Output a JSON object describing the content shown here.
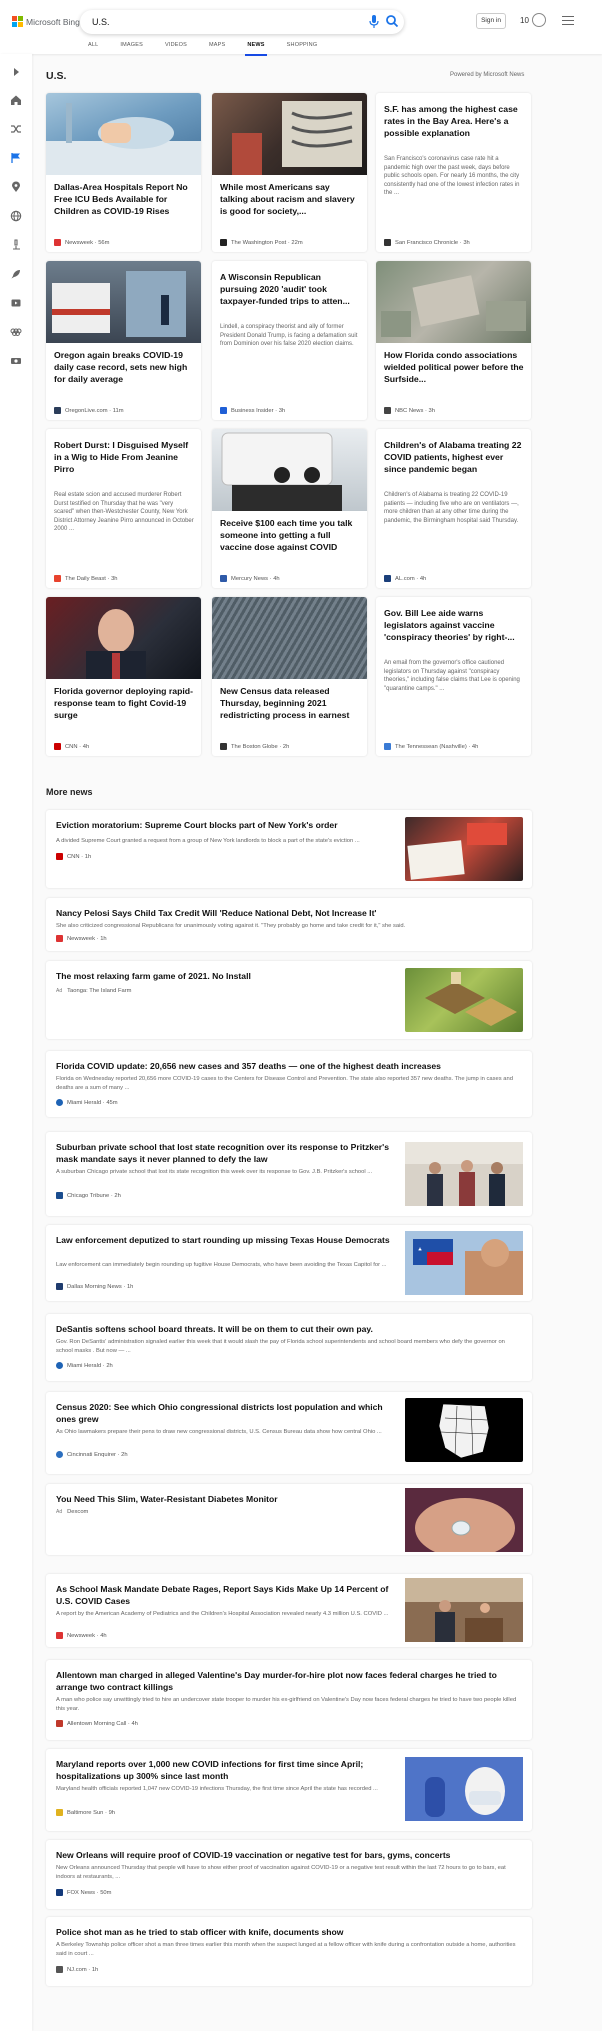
{
  "brand": {
    "name": "Microsoft Bing",
    "colors": [
      "#f25022",
      "#7fba00",
      "#00a4ef",
      "#ffb900"
    ]
  },
  "search": {
    "query": "U.S."
  },
  "header": {
    "signin": "Sign in",
    "rewards": "10"
  },
  "tabs": [
    "ALL",
    "IMAGES",
    "VIDEOS",
    "MAPS",
    "NEWS",
    "SHOPPING"
  ],
  "active_tab": "NEWS",
  "rail_icons": [
    "expand-icon",
    "home-icon",
    "shuffle-icon",
    "flag-icon",
    "location-icon",
    "globe-icon",
    "microscope-icon",
    "rocket-icon",
    "video-icon",
    "rings-icon",
    "money-icon"
  ],
  "section": {
    "title": "U.S.",
    "powered": "Powered by Microsoft News"
  },
  "cards": [
    {
      "title": "Dallas-Area Hospitals Report No Free ICU Beds Available for Children as COVID-19 Rises",
      "snippet": "",
      "source": "Newsweek",
      "time": "56m",
      "fav": "#d33"
    },
    {
      "title": "While most Americans say talking about racism and slavery is good for society,...",
      "snippet": "",
      "source": "The Washington Post",
      "time": "22m",
      "fav": "#222"
    },
    {
      "title": "S.F. has among the highest case rates in the Bay Area. Here's a possible explanation",
      "snippet": "San Francisco's coronavirus case rate hit a pandemic high over the past week, days before public schools open. For nearly 16 months, the city consistently had one of the lowest infection rates in the ...",
      "source": "San Francisco Chronicle",
      "time": "3h",
      "fav": "#333"
    },
    {
      "title": "Oregon again breaks COVID-19 daily case record, sets new high for daily average",
      "snippet": "",
      "source": "OregonLive.com",
      "time": "11m",
      "fav": "#2b3d5a"
    },
    {
      "title": "A Wisconsin Republican pursuing 2020 'audit' took taxpayer-funded trips to atten...",
      "snippet": "Lindell, a conspiracy theorist and ally of former President Donald Trump, is facing a defamation suit from Dominion over his false 2020 election claims.",
      "source": "Business Insider",
      "time": "3h",
      "fav": "#1f5fd6"
    },
    {
      "title": "How Florida condo associations wielded political power before the Surfside...",
      "snippet": "",
      "source": "NBC News",
      "time": "3h",
      "fav": "#444"
    },
    {
      "title": "Robert Durst: I Disguised Myself in a Wig to Hide From Jeanine Pirro",
      "snippet": "Real estate scion and accused murderer Robert Durst testified on Thursday that he was \"very scared\" when then-Westchester County, New York District Attorney Jeanine Pirro announced in October 2000 ...",
      "source": "The Daily Beast",
      "time": "3h",
      "fav": "#e8432e"
    },
    {
      "title": "Receive $100 each time you talk someone into getting a full vaccine dose against COVID",
      "snippet": "",
      "source": "Mercury News",
      "time": "4h",
      "fav": "#2e5aa8"
    },
    {
      "title": "Children's of Alabama treating 22 COVID patients, highest ever since pandemic began",
      "snippet": "Children's of Alabama is treating 22 COVID-19 patients — including five who are on ventilators —, more children than at any other time during the pandemic, the Birmingham hospital said Thursday.",
      "source": "AL.com",
      "time": "4h",
      "fav": "#1b3f7a"
    },
    {
      "title": "Florida governor deploying rapid-response team to fight Covid-19 surge",
      "snippet": "",
      "source": "CNN",
      "time": "4h",
      "fav": "#cc0000"
    },
    {
      "title": "New Census data released Thursday, beginning 2021 redistricting process in earnest",
      "snippet": "",
      "source": "The Boston Globe",
      "time": "2h",
      "fav": "#333"
    },
    {
      "title": "Gov. Bill Lee aide warns legislators against vaccine 'conspiracy theories' by right-...",
      "snippet": "An email from the governor's office cautioned legislators on Thursday against \"conspiracy theories,\" including false claims that Lee is opening \"quarantine camps.\" ...",
      "source": "The Tennessean (Nashville)",
      "time": "4h",
      "fav": "#3a7bd5"
    }
  ],
  "more_news": {
    "title": "More news",
    "items": [
      {
        "headline": "Eviction moratorium: Supreme Court blocks part of New York's order",
        "snippet": "A divided Supreme Court granted a request from a group of New York landlords to block a part of the state's eviction ...",
        "source": "CNN",
        "time": "1h",
        "fav": "#cc0000",
        "ad": ""
      },
      {
        "headline": "Nancy Pelosi Says Child Tax Credit Will 'Reduce National Debt, Not Increase It'",
        "snippet": "She also criticized congressional Republicans for unanimously voting against it. \"They probably go home and take credit for it,\" she said.",
        "source": "Newsweek",
        "time": "1h",
        "fav": "#d33",
        "ad": ""
      },
      {
        "headline": "The most relaxing farm game of 2021. No Install",
        "snippet": "",
        "source": "Taonga: The Island Farm",
        "time": "",
        "fav": "",
        "ad": "Ad"
      },
      {
        "headline": "Florida COVID update: 20,656 new cases and 357 deaths — one of the highest death increases",
        "snippet": "Florida on Wednesday reported 20,656 more COVID-19 cases to the Centers for Disease Control and Prevention. The state also reported 357 new deaths. The jump in cases and deaths are a sum of many ...",
        "source": "Miami Herald",
        "time": "45m",
        "fav": "#1e63b5",
        "ad": ""
      },
      {
        "headline": "Suburban private school that lost state recognition over its response to Pritzker's mask mandate says it never planned to defy the law",
        "snippet": "A suburban Chicago private school that lost its state recognition this week over its response to Gov. J.B. Pritzker's school ...",
        "source": "Chicago Tribune",
        "time": "2h",
        "fav": "#1a4d8f",
        "ad": ""
      },
      {
        "headline": "Law enforcement deputized to start rounding up missing Texas House Democrats",
        "snippet": "Law enforcement can immediately begin rounding up fugitive House Democrats, who have been avoiding the Texas Capitol for ...",
        "source": "Dallas Morning News",
        "time": "1h",
        "fav": "#1f3c6e",
        "ad": ""
      },
      {
        "headline": "DeSantis softens school board threats. It will be on them to cut their own pay.",
        "snippet": "Gov. Ron DeSantis' administration signaled earlier this week that it would slash the pay of Florida school superintendents and school board members who defy the governor on school masks . But now — ...",
        "source": "Miami Herald",
        "time": "2h",
        "fav": "#1e63b5",
        "ad": ""
      },
      {
        "headline": "Census 2020: See which Ohio congressional districts lost population and which ones grew",
        "snippet": "As Ohio lawmakers prepare their pens to draw new congressional districts, U.S. Census Bureau data show how central Ohio ...",
        "source": "Cincinnati Enquirer",
        "time": "2h",
        "fav": "#2c6fbf",
        "ad": ""
      },
      {
        "headline": "You Need This Slim, Water-Resistant Diabetes Monitor",
        "snippet": "",
        "source": "Dexcom",
        "time": "",
        "fav": "",
        "ad": "Ad"
      },
      {
        "headline": "As School Mask Mandate Debate Rages, Report Says Kids Make Up 14 Percent of U.S. COVID Cases",
        "snippet": "A report by the American Academy of Pediatrics and the Children's Hospital Association revealed nearly 4.3 million U.S. COVID ...",
        "source": "Newsweek",
        "time": "4h",
        "fav": "#d33",
        "ad": ""
      },
      {
        "headline": "Allentown man charged in alleged Valentine's Day murder-for-hire plot now faces federal charges he tried to arrange two contract killings",
        "snippet": "A man who police say unwittingly tried to hire an undercover state trooper to murder his ex-girlfriend on Valentine's Day now faces federal charges he tried to have two people killed this year.",
        "source": "Allentown Morning Call",
        "time": "4h",
        "fav": "#c0392b",
        "ad": ""
      },
      {
        "headline": "Maryland reports over 1,000 new COVID infections for first time since April; hospitalizations up 300% since last month",
        "snippet": "Maryland health officials reported 1,047 new COVID-19 infections Thursday, the first time since April the state has recorded ...",
        "source": "Baltimore Sun",
        "time": "9h",
        "fav": "#e0b21f",
        "ad": ""
      },
      {
        "headline": "New Orleans will require proof of COVID-19 vaccination or negative test for bars, gyms, concerts",
        "snippet": "New Orleans announced Thursday that people will have to show either proof of vaccination against COVID-19 or a negative test result within the last 72 hours to go to bars, eat indoors at restaurants, ...",
        "source": "FOX News",
        "time": "50m",
        "fav": "#143a7b",
        "ad": ""
      },
      {
        "headline": "Police shot man as he tried to stab officer with knife, documents show",
        "snippet": "A Berkeley Township police officer shot a man three times earlier this month when the suspect lunged at a fellow officer with knife during a confrontation outside a home, authorities said in court ...",
        "source": "NJ.com",
        "time": "1h",
        "fav": "#555",
        "ad": ""
      }
    ]
  }
}
